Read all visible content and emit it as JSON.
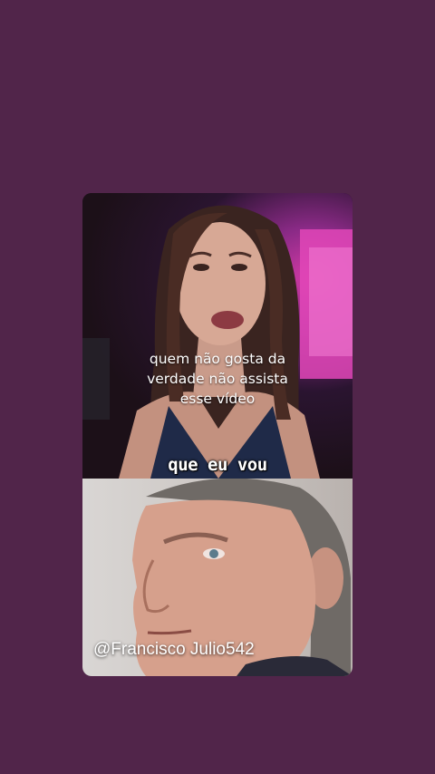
{
  "video": {
    "caption_lines": [
      "quem não gosta da",
      "verdade não assista",
      "esse vídeo"
    ],
    "subtitle": "que eu vou",
    "watermark": "@Francisco Julio542"
  },
  "colors": {
    "background": "#51254a",
    "text": "#ffffff"
  }
}
